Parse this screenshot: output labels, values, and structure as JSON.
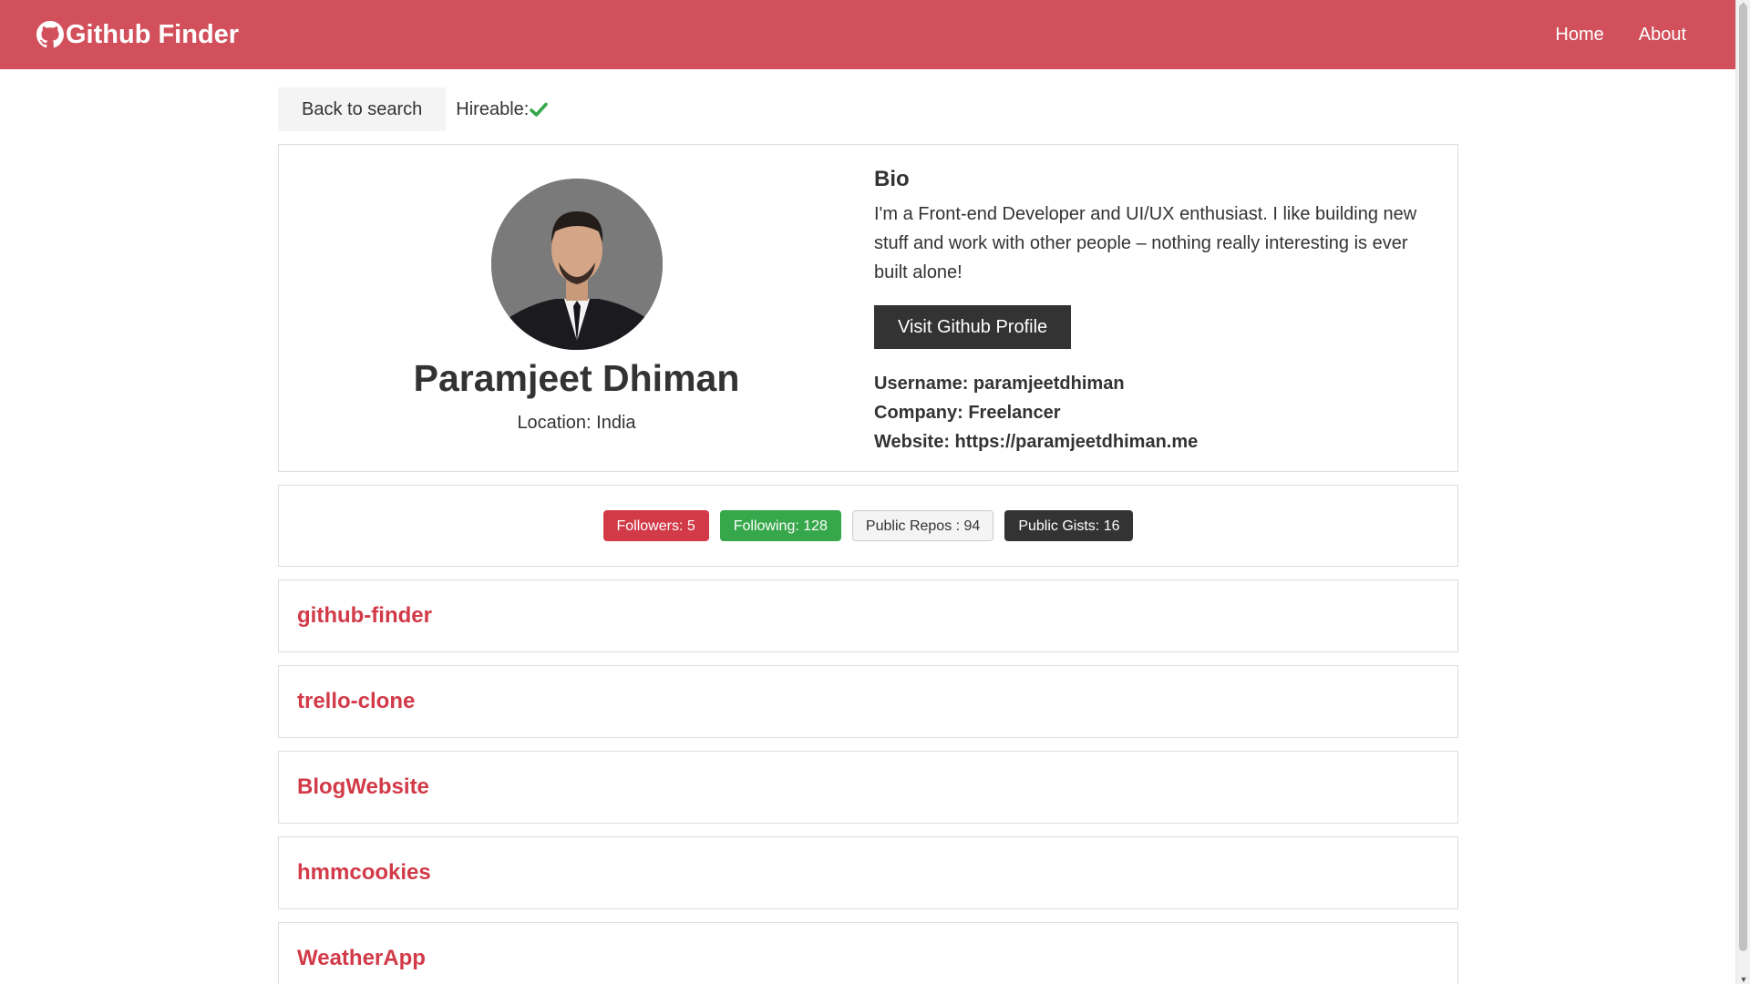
{
  "navbar": {
    "brand": "Github Finder",
    "brand_icon": "github-icon",
    "links": [
      {
        "label": "Home"
      },
      {
        "label": "About"
      }
    ],
    "color": "#d2505b"
  },
  "topbar": {
    "back_label": "Back to search",
    "hireable_label": "Hireable:",
    "hireable_icon": "check-icon",
    "hireable_color": "#36a74a"
  },
  "profile": {
    "name": "Paramjeet Dhiman",
    "location": "Location: India",
    "bio_title": "Bio",
    "bio": "I'm a Front-end Developer and UI/UX enthusiast. I like building new stuff and work with other people – nothing really interesting is ever built alone!",
    "visit_label": "Visit Github Profile",
    "username": "Username: paramjeetdhiman",
    "company": "Company: Freelancer",
    "website": "Website: https://paramjeetdhiman.me"
  },
  "stats": {
    "followers": "Followers: 5",
    "following": "Following: 128",
    "repos": "Public Repos : 94",
    "gists": "Public Gists: 16"
  },
  "repos": [
    {
      "name": "github-finder"
    },
    {
      "name": "trello-clone"
    },
    {
      "name": "BlogWebsite"
    },
    {
      "name": "hmmcookies"
    },
    {
      "name": "WeatherApp"
    }
  ]
}
